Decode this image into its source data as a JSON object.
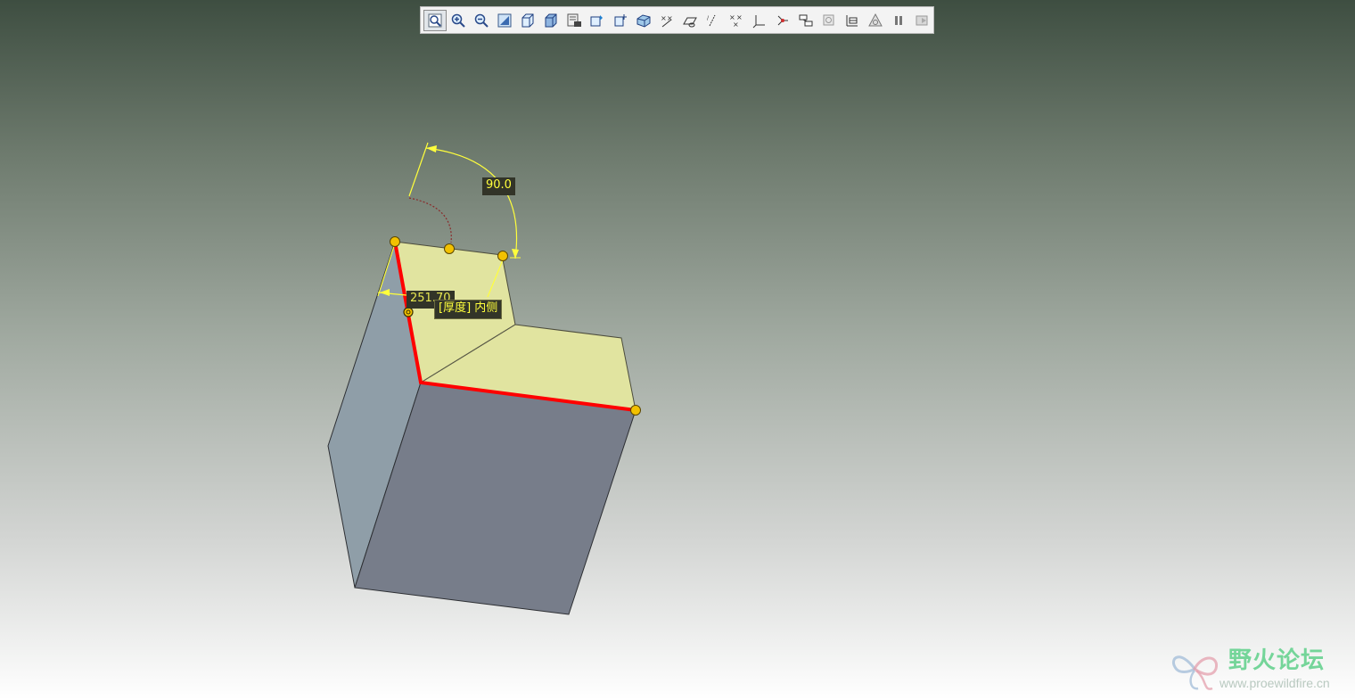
{
  "toolbar": {
    "buttons": [
      {
        "name": "refit-icon",
        "active": true
      },
      {
        "name": "zoom-in-icon"
      },
      {
        "name": "zoom-out-icon"
      },
      {
        "name": "repaint-icon"
      },
      {
        "name": "saved-views-icon"
      },
      {
        "name": "display-style-icon"
      },
      {
        "name": "view-manager-icon"
      },
      {
        "name": "perspective-view-icon"
      },
      {
        "name": "spin-center-icon"
      },
      {
        "name": "appearance-icon"
      },
      {
        "name": "datum-display-icon"
      },
      {
        "name": "datum-planes-icon"
      },
      {
        "name": "datum-axes-icon"
      },
      {
        "name": "datum-points-icon"
      },
      {
        "name": "coordinate-systems-icon"
      },
      {
        "name": "connections-icon"
      },
      {
        "name": "annotations-icon"
      },
      {
        "name": "spin-center-display-icon"
      },
      {
        "name": "3d-notes-icon"
      },
      {
        "name": "mass-properties-icon"
      },
      {
        "name": "pause-icon"
      },
      {
        "name": "exit-preview-icon"
      }
    ]
  },
  "viewport": {
    "angle_dimension": "90.0",
    "length_dimension": "251.70",
    "thickness_tag": "[厚度] 内侧",
    "colors": {
      "selected_face": "#e1e4a0",
      "left_face": "#8f9ea8",
      "front_face": "#777d8a",
      "selected_edge": "#ff0000",
      "dimension": "#ffff3c",
      "handle": "#f2c100"
    }
  },
  "watermark": {
    "title": "野火论坛",
    "url": "www.proewildfire.cn"
  }
}
